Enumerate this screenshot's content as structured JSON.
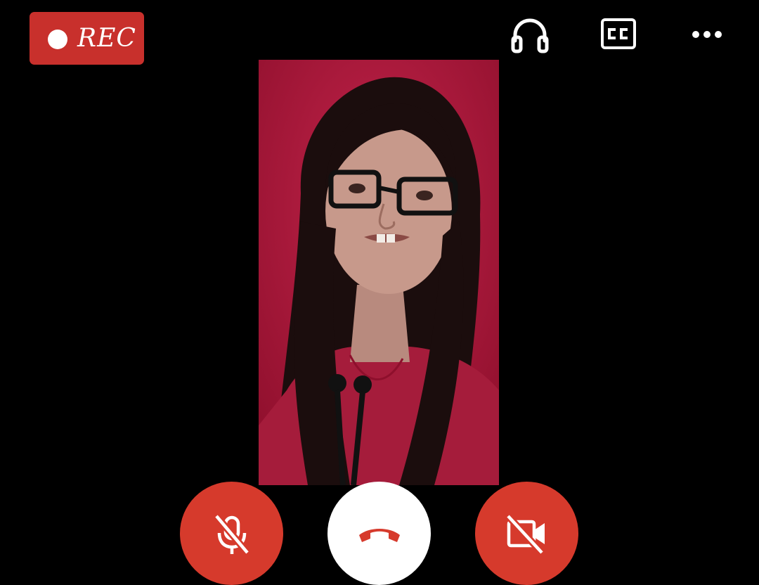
{
  "recording": {
    "label": "REC",
    "color": "#c8302c"
  },
  "toolbar": {
    "icons": [
      "headphones-icon",
      "closed-captions-icon",
      "more-options-icon"
    ]
  },
  "video": {
    "background": "#b5163a"
  },
  "controls": {
    "mic": {
      "state": "muted",
      "icon": "mic-off-icon",
      "color": "#d63a2c"
    },
    "end_call": {
      "icon": "hang-up-icon",
      "color": "#ffffff",
      "icon_color": "#d63a2c"
    },
    "camera": {
      "state": "off",
      "icon": "video-off-icon",
      "color": "#d63a2c"
    }
  }
}
